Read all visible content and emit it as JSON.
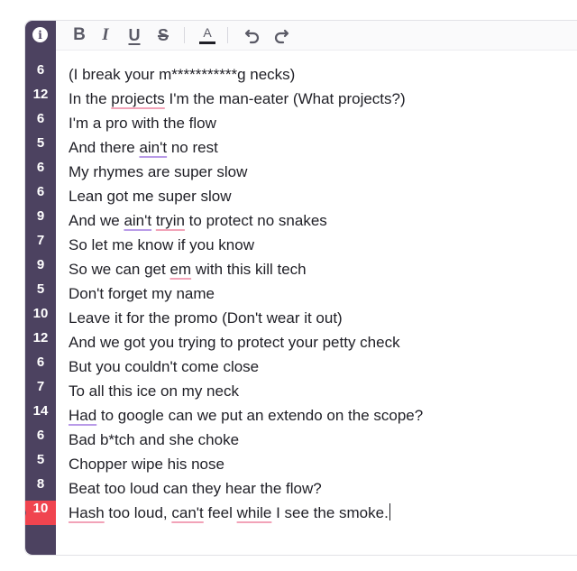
{
  "toolbar": {
    "info_icon_glyph": "i",
    "bold_label": "B",
    "italic_label": "I",
    "underline_label": "U",
    "strike_label": "S",
    "text_color_label": "A",
    "text_color": "#1f1f26",
    "undo_icon": "undo-icon",
    "redo_icon": "redo-icon"
  },
  "colors": {
    "gutter": "#4c4260",
    "active_line_marker": "#f0444f",
    "spell_error": "#f2a3b8",
    "grammar_hint": "#b99be8"
  },
  "lines": [
    {
      "count": "6",
      "segments": [
        {
          "t": "(I break your m***********g necks)"
        }
      ]
    },
    {
      "count": "12",
      "segments": [
        {
          "t": "In the "
        },
        {
          "t": "projects",
          "u": "pink"
        },
        {
          "t": " I'm the man-eater (What projects?)"
        }
      ]
    },
    {
      "count": "6",
      "segments": [
        {
          "t": "I'm a pro with the flow"
        }
      ]
    },
    {
      "count": "5",
      "segments": [
        {
          "t": "And there "
        },
        {
          "t": "ain't",
          "u": "purple"
        },
        {
          "t": " no rest"
        }
      ]
    },
    {
      "count": "6",
      "segments": [
        {
          "t": "My rhymes are super slow"
        }
      ]
    },
    {
      "count": "6",
      "segments": [
        {
          "t": "Lean got me super slow"
        }
      ]
    },
    {
      "count": "9",
      "segments": [
        {
          "t": "And we "
        },
        {
          "t": "ain't",
          "u": "purple"
        },
        {
          "t": " "
        },
        {
          "t": "tryin",
          "u": "pink"
        },
        {
          "t": " to protect no snakes"
        }
      ]
    },
    {
      "count": "7",
      "segments": [
        {
          "t": "So let me know if you know"
        }
      ]
    },
    {
      "count": "9",
      "segments": [
        {
          "t": "So we can get "
        },
        {
          "t": "em",
          "u": "pink"
        },
        {
          "t": " with this kill tech"
        }
      ]
    },
    {
      "count": "5",
      "segments": [
        {
          "t": "Don't forget my name"
        }
      ]
    },
    {
      "count": "10",
      "segments": [
        {
          "t": "Leave it for the promo (Don't wear it out)"
        }
      ]
    },
    {
      "count": "12",
      "segments": [
        {
          "t": "And we got you trying to protect your petty check"
        }
      ]
    },
    {
      "count": "6",
      "segments": [
        {
          "t": "But you couldn't come close"
        }
      ]
    },
    {
      "count": "7",
      "segments": [
        {
          "t": "To all this ice on my neck"
        }
      ]
    },
    {
      "count": "14",
      "segments": [
        {
          "t": "Had",
          "u": "purple"
        },
        {
          "t": " to google can we put an extendo on the scope?"
        }
      ]
    },
    {
      "count": "6",
      "segments": [
        {
          "t": "Bad b*tch and she choke"
        }
      ]
    },
    {
      "count": "5",
      "segments": [
        {
          "t": "Chopper wipe his nose"
        }
      ]
    },
    {
      "count": "8",
      "segments": [
        {
          "t": "Beat too loud can they hear the flow?"
        }
      ]
    },
    {
      "count": "10",
      "active": true,
      "segments": [
        {
          "t": "Hash",
          "u": "pink"
        },
        {
          "t": " too loud, "
        },
        {
          "t": "can't",
          "u": "pink"
        },
        {
          "t": " feel "
        },
        {
          "t": "while",
          "u": "pink"
        },
        {
          "t": " I see the smoke."
        }
      ]
    }
  ]
}
